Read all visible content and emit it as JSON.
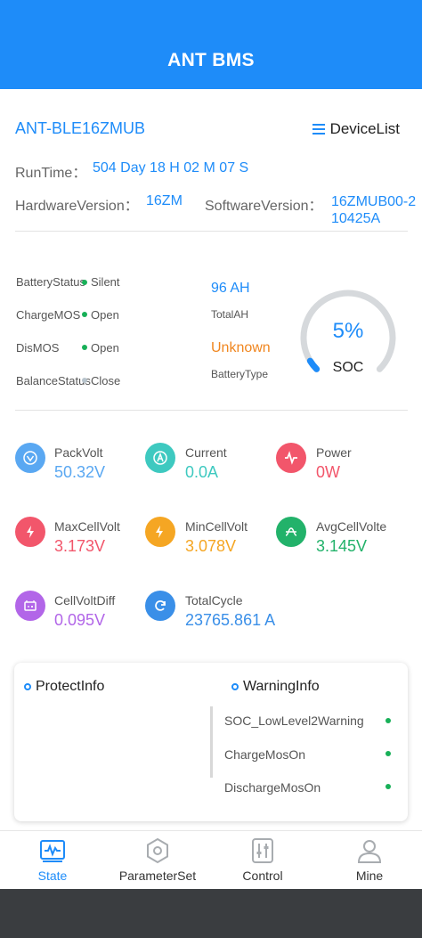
{
  "app": {
    "title": "ANT BMS"
  },
  "device": {
    "name": "ANT-BLE16ZMUB",
    "device_list_label": "DeviceList"
  },
  "info": {
    "runtime_label": "RunTime：",
    "runtime_value": "504 Day 18 H 02 M 07 S",
    "hardware_label": "HardwareVersion：",
    "hardware_value": "16ZM",
    "software_label": "SoftwareVersion：",
    "software_value": "16ZMUB00-210425A"
  },
  "status": {
    "battery_status_label": "BatteryStatus",
    "battery_status_value": "Silent",
    "charge_mos_label": "ChargeMOS",
    "charge_mos_value": "Open",
    "dis_mos_label": "DisMOS",
    "dis_mos_value": "Open",
    "balance_label": "BalanceStatus",
    "balance_value": "Close",
    "total_ah_value": "96 AH",
    "total_ah_label": "TotalAH",
    "battery_type_value": "Unknown",
    "battery_type_label": "BatteryType"
  },
  "soc": {
    "percent_text": "5%",
    "label": "SOC",
    "fraction": 0.05
  },
  "metrics": {
    "pack_volt": {
      "label": "PackVolt",
      "value": "50.32V",
      "color": "#5aa8f2",
      "icon": "triangle-down-icon"
    },
    "current": {
      "label": "Current",
      "value": "0.0A",
      "color": "#3ec9c0",
      "icon": "ampere-icon"
    },
    "power": {
      "label": "Power",
      "value": "0W",
      "color": "#f2566b",
      "icon": "pulse-icon"
    },
    "max_cell": {
      "label": "MaxCellVolt",
      "value": "3.173V",
      "color": "#f2566b",
      "icon": "lightning-plus-icon"
    },
    "min_cell": {
      "label": "MinCellVolt",
      "value": "3.078V",
      "color": "#f5a623",
      "icon": "lightning-minus-icon"
    },
    "avg_cell": {
      "label": "AvgCellVolte",
      "value": "3.145V",
      "color": "#22b26a",
      "icon": "wave-icon"
    },
    "cell_diff": {
      "label": "CellVoltDiff",
      "value": "0.095V",
      "color": "#b266e8",
      "icon": "battery-icon"
    },
    "total_cycle": {
      "label": "TotalCycle",
      "value": "23765.861 A",
      "color": "#3a8fe8",
      "icon": "refresh-icon"
    }
  },
  "protect": {
    "title": "ProtectInfo"
  },
  "warning": {
    "title": "WarningInfo",
    "items": [
      "SOC_LowLevel2Warning",
      "ChargeMosOn",
      "DischargeMosOn"
    ]
  },
  "tabs": [
    {
      "label": "State",
      "icon": "chart-icon",
      "active": true
    },
    {
      "label": "ParameterSet",
      "icon": "hexagon-icon",
      "active": false
    },
    {
      "label": "Control",
      "icon": "sliders-icon",
      "active": false
    },
    {
      "label": "Mine",
      "icon": "user-icon",
      "active": false
    }
  ],
  "colors": {
    "primary": "#1e8cf9",
    "accent_orange": "#f0861f",
    "ok_green": "#18b058"
  }
}
